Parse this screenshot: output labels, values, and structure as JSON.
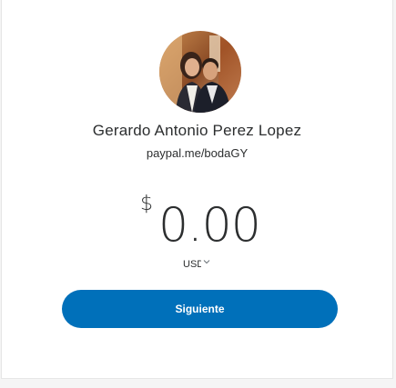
{
  "profile": {
    "name": "Gerardo Antonio Perez Lopez",
    "handle": "paypal.me/bodaGY",
    "avatar_icon": "profile-photo"
  },
  "payment": {
    "currency_symbol": "$",
    "amount": "0.00",
    "currency_code": "USD",
    "chevron_icon": "chevron-down-icon"
  },
  "actions": {
    "next_label": "Siguiente"
  },
  "colors": {
    "primary_button": "#0070ba",
    "text": "#2c2e2f",
    "background": "#f5f5f5",
    "card": "#ffffff"
  }
}
